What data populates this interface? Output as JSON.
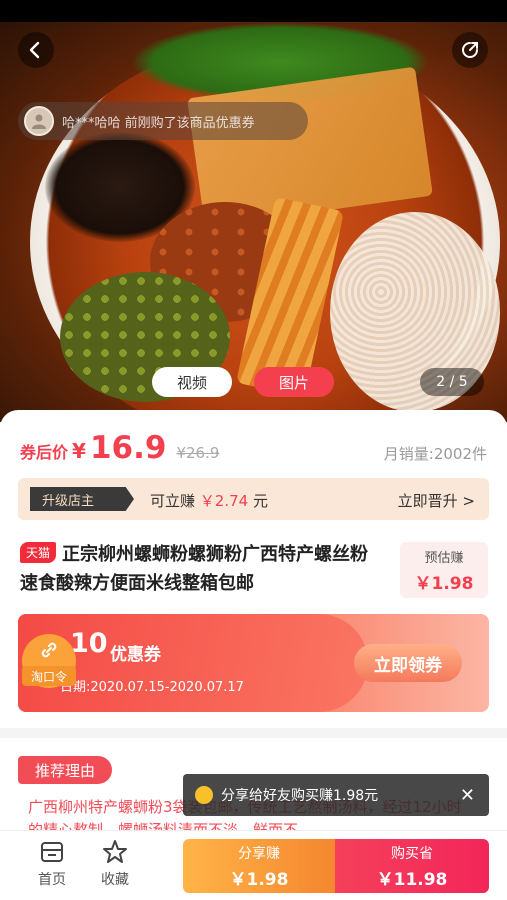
{
  "hero": {
    "toast_text": "哈***哈哈 前刚购了该商品优惠券",
    "media_tabs": [
      "视频",
      "图片"
    ],
    "pager": "2 / 5"
  },
  "price": {
    "label": "券后价",
    "currency": "¥",
    "value": "16.9",
    "original": "¥26.9",
    "sales": "月销量:2002件"
  },
  "upgrade": {
    "tag": "升级店主",
    "text_prefix": "可立赚",
    "amount": "￥2.74",
    "text_suffix": "元",
    "link": "立即晋升 >"
  },
  "product": {
    "platform_badge": "天猫",
    "title": "正宗柳州螺蛳粉螺狮粉广西特产螺丝粉速食酸辣方便面米线整箱包邮",
    "est_label": "预估赚",
    "est_value": "￥1.98"
  },
  "coupon": {
    "amount": "10",
    "name": "优惠券",
    "date": "日期:2020.07.15-2020.07.17",
    "button": "立即领券",
    "taokou_label": "淘口令"
  },
  "reason": {
    "tag": "推荐理由",
    "text": "广西柳州特产螺蛳粉3袋装包邮，传统工艺熬制汤料，经过12小时的精心熬制，螺蛳汤料清而不淡，鲜而不"
  },
  "share_popup": {
    "text": "分享给好友购买赚1.98元",
    "close": "✕"
  },
  "bottom": {
    "home": "首页",
    "favorite": "收藏",
    "share_label": "分享赚",
    "share_value": "￥1.98",
    "buy_label": "购买省",
    "buy_value": "￥11.98"
  },
  "colors": {
    "accent": "#f43f4f",
    "share_button": "#f5862f",
    "buy_button": "#f3265a"
  }
}
